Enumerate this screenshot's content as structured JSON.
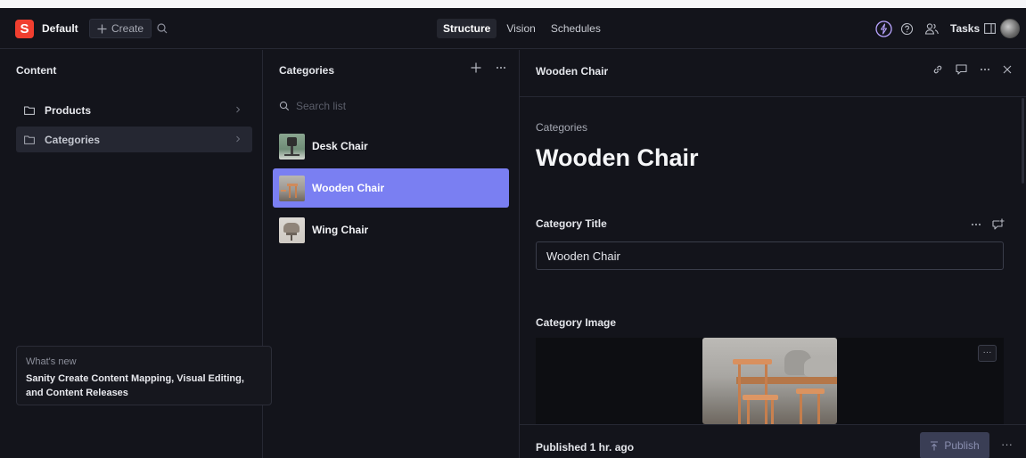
{
  "topbar": {
    "logo_letter": "S",
    "workspace": "Default",
    "create_label": "Create",
    "nav": [
      "Structure",
      "Vision",
      "Schedules"
    ],
    "tasks_label": "Tasks"
  },
  "content_pane": {
    "title": "Content",
    "items": [
      {
        "label": "Products"
      },
      {
        "label": "Categories"
      }
    ]
  },
  "categories_pane": {
    "title": "Categories",
    "search_placeholder": "Search list",
    "items": [
      {
        "label": "Desk Chair"
      },
      {
        "label": "Wooden Chair"
      },
      {
        "label": "Wing Chair"
      }
    ]
  },
  "document": {
    "header_title": "Wooden Chair",
    "breadcrumb": "Categories",
    "heading": "Wooden Chair",
    "fields": {
      "title_label": "Category Title",
      "title_value": "Wooden Chair",
      "image_label": "Category Image",
      "image_menu": "···"
    },
    "footer": {
      "status": "Published 1 hr. ago",
      "publish_label": "Publish",
      "more": "···"
    }
  },
  "whats_new": {
    "label": "What's new",
    "text": "Sanity Create Content Mapping, Visual Editing, and Content Releases"
  },
  "colors": {
    "background": "#13141b",
    "selected_item": "#7a7ff2",
    "logo": "#f03e2f",
    "accent_icon": "#b8a4ff"
  }
}
